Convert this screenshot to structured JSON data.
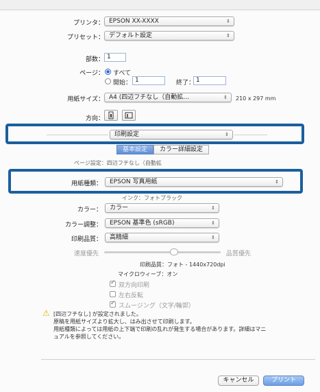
{
  "printer": {
    "label": "プリンタ：",
    "value": "EPSON XX-XXXX"
  },
  "preset": {
    "label": "プリセット：",
    "value": "デフォルト設定"
  },
  "copies": {
    "label": "部数：",
    "value": "1"
  },
  "pages": {
    "label": "ページ：",
    "all_label": "すべて",
    "from_label": "開始：",
    "from_value": "1",
    "to_label": "終了：",
    "to_value": "1"
  },
  "paper_size": {
    "label": "用紙サイズ：",
    "value": "A4 (四辺フチなし（自動拡…",
    "dimensions": "210 x 297 mm"
  },
  "orientation": {
    "label": "方向："
  },
  "section_menu": {
    "value": "印刷設定"
  },
  "tabs": [
    {
      "label": "基本設定"
    },
    {
      "label": "カラー詳細設定"
    }
  ],
  "partial_line_upper": "ページ設定：四辺フチなし（自動拡",
  "paper_type": {
    "label": "用紙種類：",
    "value": "EPSON 写真用紙"
  },
  "partial_line_lower": "インク：フォトブラック",
  "color": {
    "label": "カラー：",
    "value": "カラー"
  },
  "color_adjust": {
    "label": "カラー調整：",
    "value": "EPSON 基準色 (sRGB)"
  },
  "print_quality": {
    "label": "印刷品質：",
    "value": "高精細"
  },
  "slider": {
    "left_label": "速度優先",
    "right_label": "品質優先",
    "level": 0.6
  },
  "resolution": "印刷品質：フォト - 1440x720dpi",
  "microweave": "マイクロウィーブ：オン",
  "options": [
    {
      "label": "双方向印刷",
      "checked": true
    },
    {
      "label": "左右反転",
      "checked": false
    },
    {
      "label": "スムージング（文字/輪郭）",
      "checked": true
    }
  ],
  "warning": {
    "line1": "[四辺フチなし] が設定されました。",
    "line2": "原稿を用紙サイズより拡大し、はみ出させて印刷します。",
    "line3": "用紙種類によっては用紙の上下端で印刷の乱れが発生する場合があります。詳細はマニ",
    "line4": "ュアルを参照してください。"
  },
  "buttons": {
    "cancel": "キャンセル",
    "print": "プリント"
  },
  "colors": {
    "highlight": "#1b5f9e",
    "accent": "#2b62c9",
    "warning": "#e5b500"
  }
}
